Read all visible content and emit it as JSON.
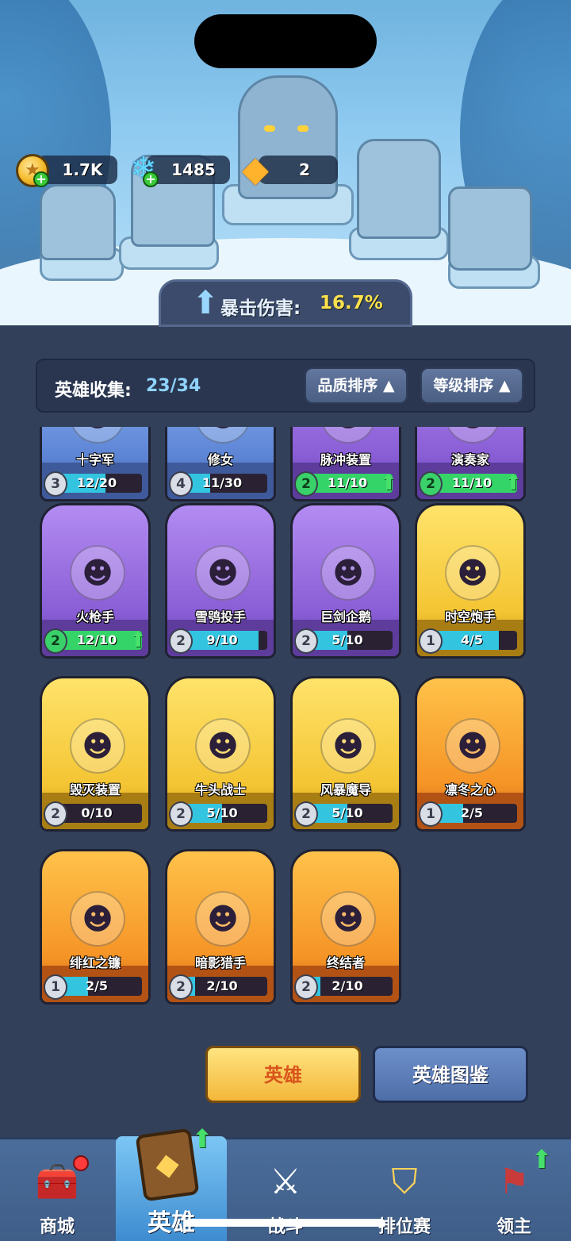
{
  "currencies": [
    {
      "icon": "gold-coin-icon",
      "value": "1.7K"
    },
    {
      "icon": "blue-gem-icon",
      "value": "1485"
    },
    {
      "icon": "orange-crystal-icon",
      "value": "2"
    }
  ],
  "buff": {
    "label": "暴击伤害:",
    "value": "16.7%"
  },
  "collection": {
    "label": "英雄收集:",
    "count": "23/34"
  },
  "sort_buttons": [
    {
      "label": "品质排序 ▲"
    },
    {
      "label": "等级排序 ▲"
    }
  ],
  "heroes": [
    {
      "name": "十字军",
      "level": "3",
      "progress": "12/20",
      "fill": 0.6,
      "rarity": "blue",
      "can_upgrade": false,
      "icon": "crusader-portrait-icon"
    },
    {
      "name": "修女",
      "level": "4",
      "progress": "11/30",
      "fill": 0.37,
      "rarity": "blue",
      "can_upgrade": false,
      "icon": "nun-portrait-icon"
    },
    {
      "name": "脉冲装置",
      "level": "2",
      "progress": "11/10",
      "fill": 1,
      "rarity": "purple",
      "can_upgrade": true,
      "icon": "pulse-device-portrait-icon"
    },
    {
      "name": "演奏家",
      "level": "2",
      "progress": "11/10",
      "fill": 1,
      "rarity": "purple",
      "can_upgrade": true,
      "icon": "musician-portrait-icon"
    },
    {
      "name": "火枪手",
      "level": "2",
      "progress": "12/10",
      "fill": 1,
      "rarity": "purple",
      "can_upgrade": true,
      "icon": "musketeer-portrait-icon"
    },
    {
      "name": "雪鸮投手",
      "level": "2",
      "progress": "9/10",
      "fill": 0.9,
      "rarity": "purple",
      "can_upgrade": false,
      "icon": "snow-owl-portrait-icon"
    },
    {
      "name": "巨剑企鹅",
      "level": "2",
      "progress": "5/10",
      "fill": 0.5,
      "rarity": "purple",
      "can_upgrade": false,
      "icon": "sword-penguin-portrait-icon"
    },
    {
      "name": "时空炮手",
      "level": "1",
      "progress": "4/5",
      "fill": 0.8,
      "rarity": "yellow",
      "can_upgrade": false,
      "icon": "time-gunner-portrait-icon"
    },
    {
      "name": "毁灭装置",
      "level": "2",
      "progress": "0/10",
      "fill": 0,
      "rarity": "yellow",
      "can_upgrade": false,
      "icon": "doom-device-portrait-icon"
    },
    {
      "name": "牛头战士",
      "level": "2",
      "progress": "5/10",
      "fill": 0.5,
      "rarity": "yellow",
      "can_upgrade": false,
      "icon": "minotaur-portrait-icon"
    },
    {
      "name": "风暴魔导",
      "level": "2",
      "progress": "5/10",
      "fill": 0.5,
      "rarity": "yellow",
      "can_upgrade": false,
      "icon": "storm-mage-portrait-icon"
    },
    {
      "name": "凛冬之心",
      "level": "1",
      "progress": "2/5",
      "fill": 0.4,
      "rarity": "orange",
      "can_upgrade": false,
      "icon": "winter-heart-portrait-icon"
    },
    {
      "name": "绯红之镰",
      "level": "1",
      "progress": "2/5",
      "fill": 0.4,
      "rarity": "orange",
      "can_upgrade": false,
      "icon": "crimson-scythe-portrait-icon"
    },
    {
      "name": "暗影猎手",
      "level": "2",
      "progress": "2/10",
      "fill": 0.2,
      "rarity": "orange",
      "can_upgrade": false,
      "icon": "shadow-hunter-portrait-icon"
    },
    {
      "name": "终结者",
      "level": "2",
      "progress": "2/10",
      "fill": 0.2,
      "rarity": "orange",
      "can_upgrade": false,
      "icon": "terminator-portrait-icon"
    }
  ],
  "buttons": {
    "hero": "英雄",
    "codex": "英雄图鉴"
  },
  "tabs": [
    {
      "label": "商城",
      "icon": "shop-chest-icon"
    },
    {
      "label": "英雄",
      "icon": "hero-card-icon"
    },
    {
      "label": "战斗",
      "icon": "crossed-swords-icon"
    },
    {
      "label": "排位赛",
      "icon": "rank-shield-icon"
    },
    {
      "label": "领主",
      "icon": "lord-banner-icon"
    }
  ],
  "colors": {
    "accent_blue": "#8fd3ff",
    "buff_yellow": "#ffe14d",
    "upgrade_green": "#46e06b"
  }
}
